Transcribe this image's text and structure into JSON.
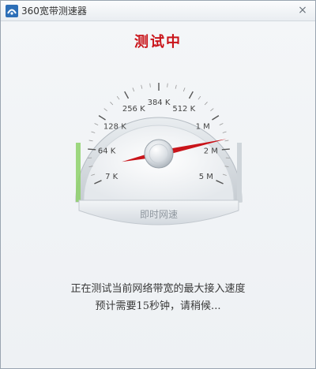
{
  "window": {
    "title": "360宽带测速器",
    "close_glyph": "×"
  },
  "status": {
    "heading": "测试中"
  },
  "gauge": {
    "ticks": [
      "7 K",
      "64 K",
      "128 K",
      "256 K",
      "384 K",
      "512 K",
      "1 M",
      "2 M",
      "5 M"
    ],
    "label": "即时网速",
    "needle_tick_position": 6.7,
    "accent_color": "#c9141a",
    "progress_color": "#8ed16a"
  },
  "messages": {
    "line1": "正在测试当前网络带宽的最大接入速度",
    "line2": "预计需要15秒钟，请稍候..."
  }
}
